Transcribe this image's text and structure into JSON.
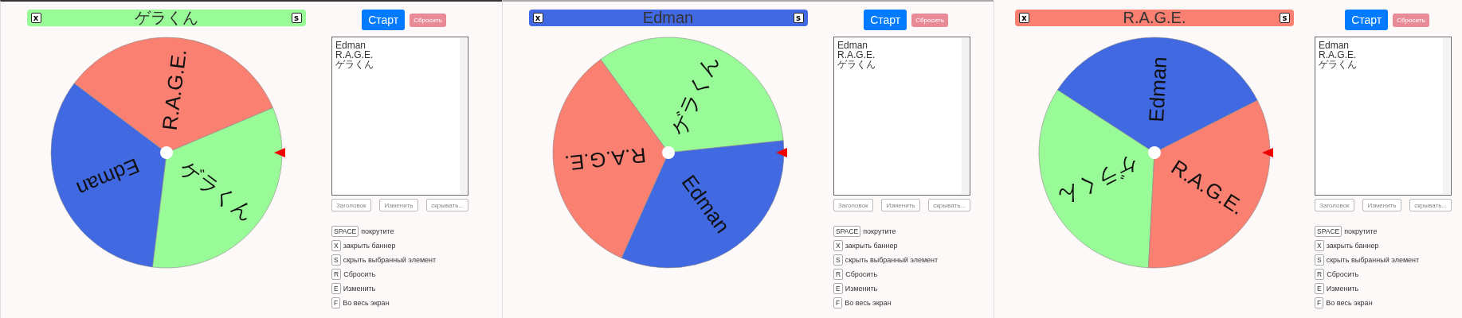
{
  "panels": [
    {
      "banner": {
        "text": "ゲラくん",
        "color": "#98fb98",
        "close_key": "x",
        "hide_key": "s"
      },
      "wheel": {
        "segments": [
          {
            "label": "ゲラくん",
            "color": "#98fb98"
          },
          {
            "label": "Edman",
            "color": "#4169e1"
          },
          {
            "label": "R.A.G.E.",
            "color": "#fa8072"
          }
        ]
      },
      "start_button": "Старт",
      "reset_button": "Сбросить",
      "entries": [
        "Edman",
        "R.A.G.E.",
        "ゲラくん"
      ],
      "actions": [
        "Заголовок",
        "Изменить",
        "скрывать..."
      ],
      "shortcuts": [
        {
          "key": "SPACE",
          "text": "покрутите"
        },
        {
          "key": "X",
          "text": "закрыть баннер"
        },
        {
          "key": "S",
          "text": "скрыть выбранный элемент"
        },
        {
          "key": "R",
          "text": "Сбросить"
        },
        {
          "key": "E",
          "text": "Изменить"
        },
        {
          "key": "F",
          "text": "Во весь экран"
        }
      ]
    },
    {
      "banner": {
        "text": "Edman",
        "color": "#4169e1",
        "close_key": "x",
        "hide_key": "s"
      },
      "wheel": {
        "segments": [
          {
            "label": "ゲラくん",
            "color": "#98fb98"
          },
          {
            "label": "Edman",
            "color": "#4169e1"
          },
          {
            "label": "R.A.G.E.",
            "color": "#fa8072"
          }
        ]
      },
      "start_button": "Старт",
      "reset_button": "Сбросить",
      "entries": [
        "Edman",
        "R.A.G.E.",
        "ゲラくん"
      ],
      "actions": [
        "Заголовок",
        "Изменить",
        "скрывать..."
      ],
      "shortcuts": [
        {
          "key": "SPACE",
          "text": "покрутите"
        },
        {
          "key": "X",
          "text": "закрыть баннер"
        },
        {
          "key": "S",
          "text": "скрыть выбранный элемент"
        },
        {
          "key": "R",
          "text": "Сбросить"
        },
        {
          "key": "E",
          "text": "Изменить"
        },
        {
          "key": "F",
          "text": "Во весь экран"
        }
      ]
    },
    {
      "banner": {
        "text": "R.A.G.E.",
        "color": "#fa8072",
        "close_key": "x",
        "hide_key": "s"
      },
      "wheel": {
        "segments": [
          {
            "label": "ゲラくん",
            "color": "#98fb98"
          },
          {
            "label": "Edman",
            "color": "#4169e1"
          },
          {
            "label": "R.A.G.E.",
            "color": "#fa8072"
          }
        ]
      },
      "start_button": "Старт",
      "reset_button": "Сбросить",
      "entries": [
        "Edman",
        "R.A.G.E.",
        "ゲラくん"
      ],
      "actions": [
        "Заголовок",
        "Изменить",
        "скрывать..."
      ],
      "shortcuts": [
        {
          "key": "SPACE",
          "text": "покрутите"
        },
        {
          "key": "X",
          "text": "закрыть баннер"
        },
        {
          "key": "S",
          "text": "скрыть выбранный элемент"
        },
        {
          "key": "R",
          "text": "Сбросить"
        },
        {
          "key": "E",
          "text": "Изменить"
        },
        {
          "key": "F",
          "text": "Во весь экран"
        }
      ]
    }
  ]
}
